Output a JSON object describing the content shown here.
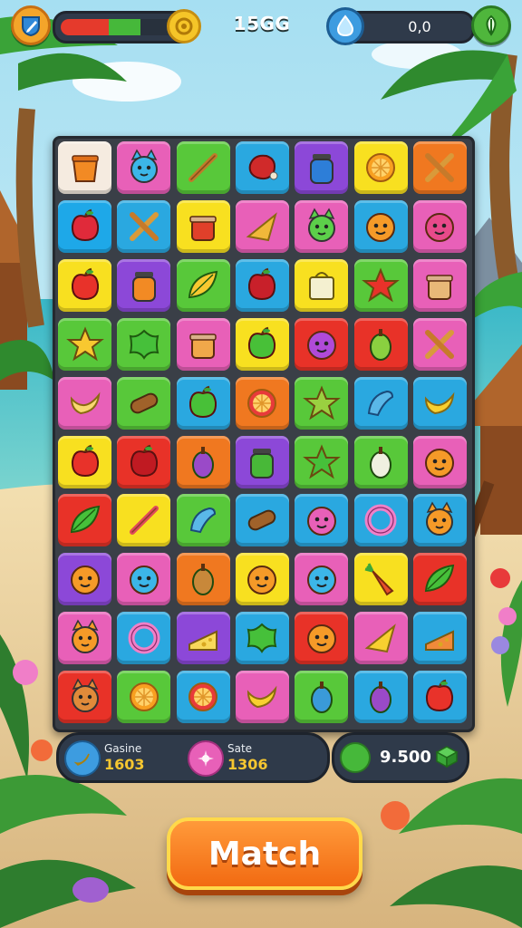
{
  "hud": {
    "menu_icon": "shield-pencil-icon",
    "health_percent": 70,
    "health_red_percent": 42,
    "coin_icon": "coin-icon",
    "score": "15GG",
    "gem_icon": "water-drop-icon",
    "gem_value": "0,0",
    "hint_icon": "leaf-icon"
  },
  "board": {
    "columns": 7,
    "rows": 10,
    "tiles": [
      [
        "#f5ebe0:bucket",
        "#e860b8:blue-cat",
        "#58c83a:stick",
        "#2aa8e0:red-meat",
        "#8c48d8:blue-jar",
        "#f8e020:orange-slice",
        "#f07820:cross-sticks"
      ],
      [
        "#1ea8e8:strawberry",
        "#2aa8e0:cross-sticks",
        "#f8e020:flower-pot",
        "#e860b8:broom",
        "#e860b8:green-cat",
        "#2aa8e0:orange-face",
        "#e860b8:radish-face"
      ],
      [
        "#f8e020:apple",
        "#8c48d8:orange-jar",
        "#58c83a:yellow-leaf",
        "#2aa8e0:red-fruit",
        "#f8e020:bag",
        "#58c83a:red-fan",
        "#e860b8:gift-basket"
      ],
      [
        "#58c83a:star",
        "#58c83a:green-blob",
        "#e860b8:honey-pot",
        "#f8e020:green-apple",
        "#e83228:purple-face",
        "#e83228:green-gourd",
        "#e860b8:cross-sticks"
      ],
      [
        "#e860b8:yellow-pepper",
        "#58c83a:log",
        "#2aa8e0:green-apple",
        "#f07820:watermelon",
        "#58c83a:green-flower",
        "#2aa8e0:blue-fish",
        "#2aa8e0:banana"
      ],
      [
        "#f8e020:apple",
        "#e83228:red-apple",
        "#f07820:eggplant",
        "#8c48d8:green-jar",
        "#58c83a:green-star",
        "#58c83a:white-bean",
        "#e860b8:orange-face"
      ],
      [
        "#e83228:green-leaf",
        "#f8e020:red-stick",
        "#58c83a:blue-fish",
        "#2aa8e0:log",
        "#2aa8e0:pink-face",
        "#2aa8e0:pink-ring",
        "#2aa8e0:orange-cat"
      ],
      [
        "#8c48d8:orange-face",
        "#e860b8:blue-face",
        "#f07820:potato",
        "#f8e020:orange-face",
        "#e860b8:blue-face",
        "#f8e020:carrot",
        "#e83228:green-leaf"
      ],
      [
        "#e860b8:orange-cat",
        "#2aa8e0:pink-ring",
        "#8c48d8:cheese",
        "#2aa8e0:green-blob",
        "#e83228:orange-face",
        "#e860b8:yellow-cone",
        "#2aa8e0:cake-slice"
      ],
      [
        "#e83228:fox-face",
        "#58c83a:orange-slice",
        "#2aa8e0:watermelon",
        "#e860b8:banana",
        "#58c83a:blue-gourd",
        "#2aa8e0:eggplant",
        "#2aa8e0:apple"
      ]
    ]
  },
  "stats": {
    "gasine_icon": "banana-icon",
    "gasine_label": "Gasine",
    "gasine_value": "1603",
    "sate_icon": "pink-flower-icon",
    "sate_label": "Sate",
    "sate_value": "1306",
    "money_icon": "green-orb-icon",
    "money_value": "9.500",
    "cash_icon": "cash-stack-icon"
  },
  "match_button": {
    "label": "Match"
  }
}
